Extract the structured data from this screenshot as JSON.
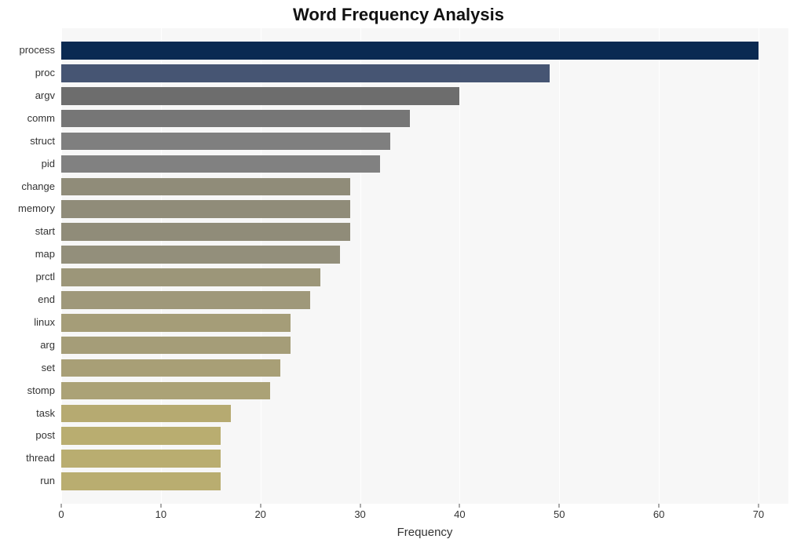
{
  "chart_data": {
    "type": "bar",
    "orientation": "horizontal",
    "title": "Word Frequency Analysis",
    "xlabel": "Frequency",
    "ylabel": "",
    "xlim": [
      0,
      73
    ],
    "xticks": [
      0,
      10,
      20,
      30,
      40,
      50,
      60,
      70
    ],
    "categories": [
      "process",
      "proc",
      "argv",
      "comm",
      "struct",
      "pid",
      "change",
      "memory",
      "start",
      "map",
      "prctl",
      "end",
      "linux",
      "arg",
      "set",
      "stomp",
      "task",
      "post",
      "thread",
      "run"
    ],
    "values": [
      70,
      49,
      40,
      35,
      33,
      32,
      29,
      29,
      29,
      28,
      26,
      25,
      23,
      23,
      22,
      21,
      17,
      16,
      16,
      16
    ],
    "colors": [
      "#0a2a52",
      "#465573",
      "#6d6d6d",
      "#767676",
      "#7f7f7f",
      "#818181",
      "#908c79",
      "#908c79",
      "#908c79",
      "#938f7b",
      "#9c9679",
      "#9f987a",
      "#a59d78",
      "#a59d78",
      "#a89f76",
      "#aba276",
      "#b6aa71",
      "#b9ad70",
      "#b9ad70",
      "#b9ad70"
    ]
  }
}
